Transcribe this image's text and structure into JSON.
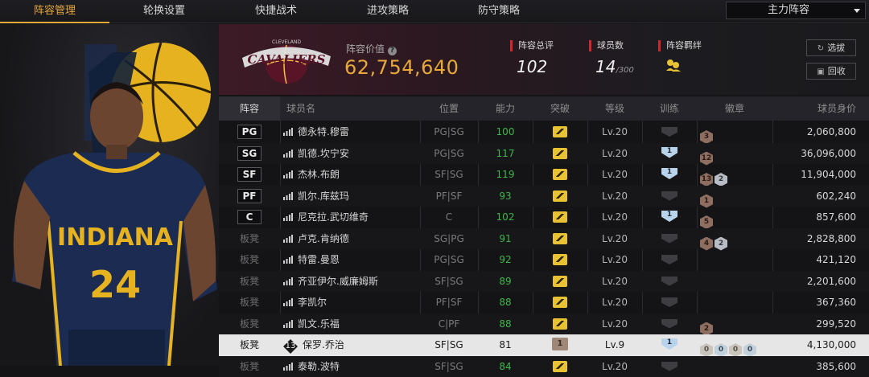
{
  "tabs": [
    {
      "label": "阵容管理",
      "active": true
    },
    {
      "label": "轮换设置",
      "active": false
    },
    {
      "label": "快捷战术",
      "active": false
    },
    {
      "label": "进攻策略",
      "active": false
    },
    {
      "label": "防守策略",
      "active": false
    }
  ],
  "lineup_select": {
    "value": "主力阵容"
  },
  "team": {
    "logo_text": "CAVALIERS",
    "logo_subtext": "CLEVELAND",
    "value_label": "阵容价值",
    "value": "62,754,640",
    "rating_label": "阵容总评",
    "rating": "102",
    "players_label": "球员数",
    "players": "14",
    "players_max": "/300",
    "chem_label": "阵容羁绊"
  },
  "buttons": {
    "pick": "选拔",
    "recycle": "回收"
  },
  "player_card": {
    "jersey_team": "INDIANA",
    "jersey_number": "24"
  },
  "table": {
    "headers": {
      "lineup": "阵容",
      "name": "球员名",
      "position": "位置",
      "ability": "能力",
      "breakthrough": "突破",
      "level": "等级",
      "training": "训练",
      "badges": "徽章",
      "worth": "球员身价"
    },
    "rows": [
      {
        "slot": "PG",
        "name": "德永特.穆雷",
        "position": "PG|SG",
        "ability": "100",
        "level": "Lv.20",
        "train": "",
        "badges": [
          "3"
        ],
        "worth": "2,060,800"
      },
      {
        "slot": "SG",
        "name": "凯德.坎宁安",
        "position": "PG|SG",
        "ability": "117",
        "level": "Lv.20",
        "train": "1",
        "badges": [
          "12"
        ],
        "worth": "36,096,000"
      },
      {
        "slot": "SF",
        "name": "杰林.布朗",
        "position": "SF|SG",
        "ability": "119",
        "level": "Lv.20",
        "train": "1",
        "badges": [
          "13",
          "2"
        ],
        "worth": "11,904,000"
      },
      {
        "slot": "PF",
        "name": "凯尔.库兹玛",
        "position": "PF|SF",
        "ability": "93",
        "level": "Lv.20",
        "train": "",
        "badges": [
          "1"
        ],
        "worth": "602,240"
      },
      {
        "slot": "C",
        "name": "尼克拉.武切维奇",
        "position": "C",
        "ability": "102",
        "level": "Lv.20",
        "train": "1",
        "badges": [
          "5"
        ],
        "worth": "857,600"
      },
      {
        "slot": "板凳",
        "name": "卢克.肯纳德",
        "position": "SG|PG",
        "ability": "91",
        "level": "Lv.20",
        "train": "",
        "badges": [
          "4",
          "2"
        ],
        "worth": "2,828,800"
      },
      {
        "slot": "板凳",
        "name": "特雷.曼恩",
        "position": "PG|SG",
        "ability": "92",
        "level": "Lv.20",
        "train": "",
        "badges": [],
        "worth": "421,120"
      },
      {
        "slot": "板凳",
        "name": "齐亚伊尔.威廉姆斯",
        "position": "SF|SG",
        "ability": "89",
        "level": "Lv.20",
        "train": "",
        "badges": [],
        "worth": "2,201,600"
      },
      {
        "slot": "板凳",
        "name": "李凯尔",
        "position": "PF|SF",
        "ability": "88",
        "level": "Lv.20",
        "train": "",
        "badges": [],
        "worth": "367,360"
      },
      {
        "slot": "板凳",
        "name": "凯文.乐福",
        "position": "C|PF",
        "ability": "88",
        "level": "Lv.20",
        "train": "",
        "badges": [
          "2"
        ],
        "worth": "299,520"
      },
      {
        "slot": "板凳",
        "name": "保罗.乔治",
        "number": "13",
        "position": "SF|SG",
        "ability": "81",
        "break": "1",
        "level": "Lv.9",
        "train": "1",
        "badges": [
          "0",
          "0",
          "0",
          "0"
        ],
        "worth": "4,130,000",
        "selected": true
      },
      {
        "slot": "板凳",
        "name": "泰勒.波特",
        "position": "SF|SG",
        "ability": "84",
        "level": "Lv.20",
        "train": "",
        "badges": [],
        "worth": "385,600"
      }
    ]
  },
  "colors": {
    "accent": "#e8a83a",
    "ability_green": "#3fb64a",
    "header_red": "#d4262e",
    "crown_gold": "#e8c233"
  }
}
